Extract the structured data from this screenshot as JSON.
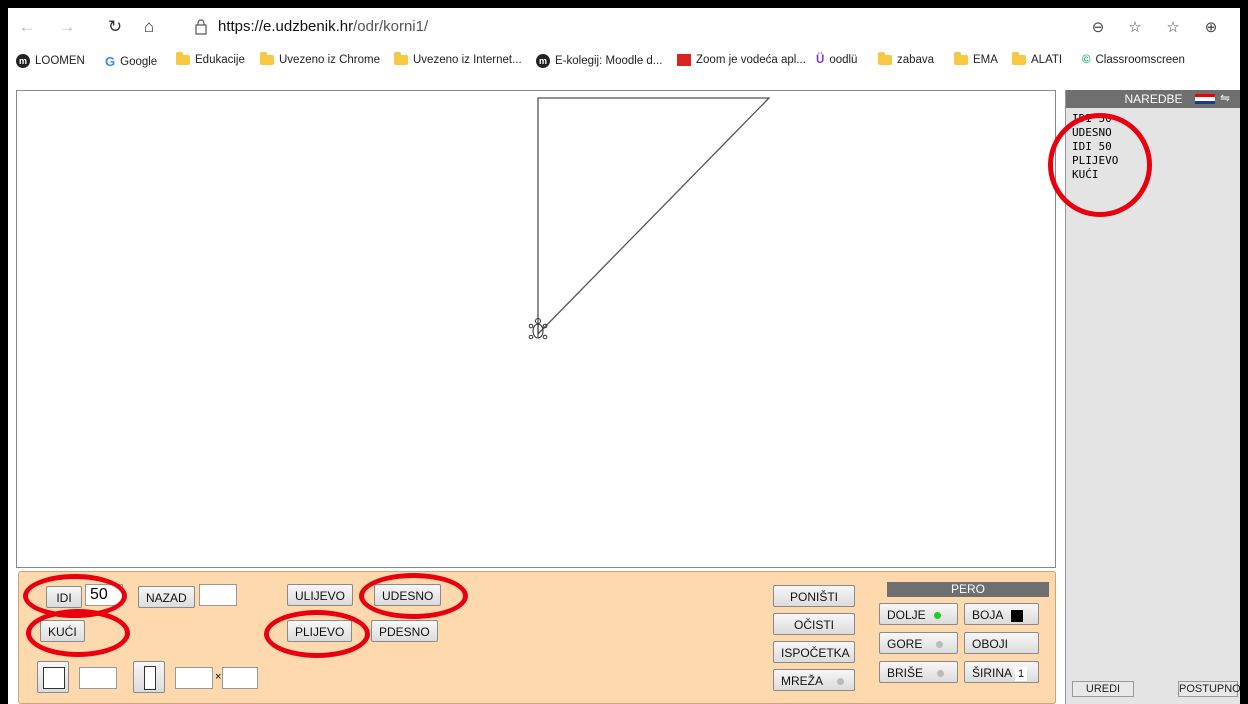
{
  "browser": {
    "url_host": "https://e.udzbenik.hr",
    "url_path": "/odr/korni1/"
  },
  "bookmarks": [
    {
      "label": "LOOMEN",
      "icon": "moodle-icon"
    },
    {
      "label": "Google",
      "icon": "google-icon"
    },
    {
      "label": "Edukacije",
      "icon": "folder-icon"
    },
    {
      "label": "Uvezeno iz Chrome",
      "icon": "folder-icon"
    },
    {
      "label": "Uvezeno iz Internet...",
      "icon": "folder-icon"
    },
    {
      "label": "E-kolegij: Moodle d...",
      "icon": "moodle-icon"
    },
    {
      "label": "Zoom je vodeća apl...",
      "icon": "zoom-icon"
    },
    {
      "label": "oodlü",
      "icon": "oodlu-icon"
    },
    {
      "label": "zabava",
      "icon": "folder-icon"
    },
    {
      "label": "EMA",
      "icon": "folder-icon"
    },
    {
      "label": "ALATI",
      "icon": "folder-icon"
    },
    {
      "label": "Classroomscreen",
      "icon": "classroomscreen-icon"
    }
  ],
  "sidebar": {
    "title": "NAREDBE",
    "commands": [
      "IDI 50",
      "UDESNO",
      "IDI 50",
      "PLIJEVO",
      "KUĆI"
    ],
    "edit_label": "UREDI",
    "step_label": "POSTUPNO"
  },
  "controls": {
    "forward_label": "IDI",
    "forward_value": "50",
    "back_label": "NAZAD",
    "back_value": "",
    "left_label": "ULIJEVO",
    "right_label": "UDESNO",
    "home_label": "KUĆI",
    "pleft_label": "PLIJEVO",
    "pright_label": "PDESNO",
    "times_sign": "×",
    "undo_label": "PONIŠTI",
    "clear_label": "OČISTI",
    "restart_label": "ISPOČETKA",
    "grid_label": "MREŽA"
  },
  "pen": {
    "title": "PERO",
    "down_label": "DOLJE",
    "up_label": "GORE",
    "erase_label": "BRIŠE",
    "color_label": "BOJA",
    "fill_label": "OBOJI",
    "width_label": "ŠIRINA",
    "width_value": "1",
    "active_color": "#22cc22",
    "pen_color": "#000000"
  }
}
